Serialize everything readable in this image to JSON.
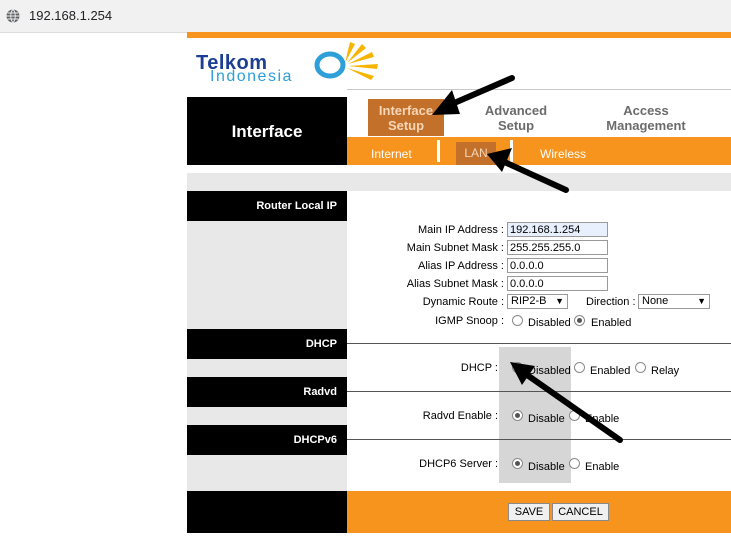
{
  "browser": {
    "url": "192.168.1.254"
  },
  "logo": {
    "line1": "Telkom",
    "line2": "Indonesia"
  },
  "nav": {
    "title": "Interface",
    "tabs": [
      {
        "label": "Interface Setup",
        "active": true
      },
      {
        "label": "Advanced Setup",
        "active": false
      },
      {
        "label": "Access Management",
        "active": false
      }
    ],
    "subtabs": [
      {
        "label": "Internet",
        "active": false
      },
      {
        "label": "LAN",
        "active": true
      },
      {
        "label": "Wireless",
        "active": false
      }
    ]
  },
  "sections": {
    "router": "Router Local IP",
    "dhcp": "DHCP",
    "radvd": "Radvd",
    "dhcpv6": "DHCPv6"
  },
  "router": {
    "main_ip_label": "Main IP Address :",
    "main_ip": "192.168.1.254",
    "main_mask_label": "Main Subnet Mask :",
    "main_mask": "255.255.255.0",
    "alias_ip_label": "Alias IP Address :",
    "alias_ip": "0.0.0.0",
    "alias_mask_label": "Alias Subnet Mask :",
    "alias_mask": "0.0.0.0",
    "dyn_route_label": "Dynamic Route :",
    "dyn_route": "RIP2-B",
    "direction_label": "Direction :",
    "direction": "None",
    "igmp_label": "IGMP Snoop :",
    "igmp_disabled": "Disabled",
    "igmp_enabled": "Enabled",
    "igmp_value": "Enabled"
  },
  "dhcp": {
    "label": "DHCP :",
    "opt_disabled": "Disabled",
    "opt_enabled": "Enabled",
    "opt_relay": "Relay",
    "value": "Disabled"
  },
  "radvd": {
    "label": "Radvd Enable :",
    "opt_disable": "Disable",
    "opt_enable": "Enable",
    "value": "Disable"
  },
  "dhcpv6": {
    "label": "DHCP6 Server :",
    "opt_disable": "Disable",
    "opt_enable": "Enable",
    "value": "Disable"
  },
  "footer": {
    "save": "SAVE",
    "cancel": "CANCEL"
  },
  "colors": {
    "orange": "#f7941d",
    "tab_active": "#c3702a",
    "black": "#000000",
    "panel_grey": "#e8e8e8"
  },
  "icons": [
    "globe-icon",
    "chevron-down-icon",
    "annotation-arrow"
  ]
}
